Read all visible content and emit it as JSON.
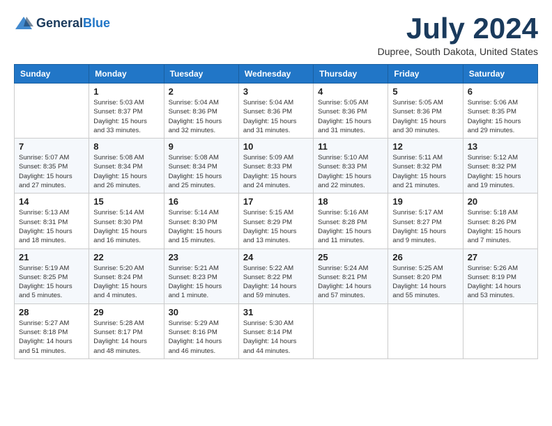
{
  "header": {
    "logo_line1": "General",
    "logo_line2": "Blue",
    "month": "July 2024",
    "location": "Dupree, South Dakota, United States"
  },
  "weekdays": [
    "Sunday",
    "Monday",
    "Tuesday",
    "Wednesday",
    "Thursday",
    "Friday",
    "Saturday"
  ],
  "weeks": [
    [
      {
        "day": "",
        "info": ""
      },
      {
        "day": "1",
        "info": "Sunrise: 5:03 AM\nSunset: 8:37 PM\nDaylight: 15 hours\nand 33 minutes."
      },
      {
        "day": "2",
        "info": "Sunrise: 5:04 AM\nSunset: 8:36 PM\nDaylight: 15 hours\nand 32 minutes."
      },
      {
        "day": "3",
        "info": "Sunrise: 5:04 AM\nSunset: 8:36 PM\nDaylight: 15 hours\nand 31 minutes."
      },
      {
        "day": "4",
        "info": "Sunrise: 5:05 AM\nSunset: 8:36 PM\nDaylight: 15 hours\nand 31 minutes."
      },
      {
        "day": "5",
        "info": "Sunrise: 5:05 AM\nSunset: 8:36 PM\nDaylight: 15 hours\nand 30 minutes."
      },
      {
        "day": "6",
        "info": "Sunrise: 5:06 AM\nSunset: 8:35 PM\nDaylight: 15 hours\nand 29 minutes."
      }
    ],
    [
      {
        "day": "7",
        "info": "Sunrise: 5:07 AM\nSunset: 8:35 PM\nDaylight: 15 hours\nand 27 minutes."
      },
      {
        "day": "8",
        "info": "Sunrise: 5:08 AM\nSunset: 8:34 PM\nDaylight: 15 hours\nand 26 minutes."
      },
      {
        "day": "9",
        "info": "Sunrise: 5:08 AM\nSunset: 8:34 PM\nDaylight: 15 hours\nand 25 minutes."
      },
      {
        "day": "10",
        "info": "Sunrise: 5:09 AM\nSunset: 8:33 PM\nDaylight: 15 hours\nand 24 minutes."
      },
      {
        "day": "11",
        "info": "Sunrise: 5:10 AM\nSunset: 8:33 PM\nDaylight: 15 hours\nand 22 minutes."
      },
      {
        "day": "12",
        "info": "Sunrise: 5:11 AM\nSunset: 8:32 PM\nDaylight: 15 hours\nand 21 minutes."
      },
      {
        "day": "13",
        "info": "Sunrise: 5:12 AM\nSunset: 8:32 PM\nDaylight: 15 hours\nand 19 minutes."
      }
    ],
    [
      {
        "day": "14",
        "info": "Sunrise: 5:13 AM\nSunset: 8:31 PM\nDaylight: 15 hours\nand 18 minutes."
      },
      {
        "day": "15",
        "info": "Sunrise: 5:14 AM\nSunset: 8:30 PM\nDaylight: 15 hours\nand 16 minutes."
      },
      {
        "day": "16",
        "info": "Sunrise: 5:14 AM\nSunset: 8:30 PM\nDaylight: 15 hours\nand 15 minutes."
      },
      {
        "day": "17",
        "info": "Sunrise: 5:15 AM\nSunset: 8:29 PM\nDaylight: 15 hours\nand 13 minutes."
      },
      {
        "day": "18",
        "info": "Sunrise: 5:16 AM\nSunset: 8:28 PM\nDaylight: 15 hours\nand 11 minutes."
      },
      {
        "day": "19",
        "info": "Sunrise: 5:17 AM\nSunset: 8:27 PM\nDaylight: 15 hours\nand 9 minutes."
      },
      {
        "day": "20",
        "info": "Sunrise: 5:18 AM\nSunset: 8:26 PM\nDaylight: 15 hours\nand 7 minutes."
      }
    ],
    [
      {
        "day": "21",
        "info": "Sunrise: 5:19 AM\nSunset: 8:25 PM\nDaylight: 15 hours\nand 5 minutes."
      },
      {
        "day": "22",
        "info": "Sunrise: 5:20 AM\nSunset: 8:24 PM\nDaylight: 15 hours\nand 4 minutes."
      },
      {
        "day": "23",
        "info": "Sunrise: 5:21 AM\nSunset: 8:23 PM\nDaylight: 15 hours\nand 1 minute."
      },
      {
        "day": "24",
        "info": "Sunrise: 5:22 AM\nSunset: 8:22 PM\nDaylight: 14 hours\nand 59 minutes."
      },
      {
        "day": "25",
        "info": "Sunrise: 5:24 AM\nSunset: 8:21 PM\nDaylight: 14 hours\nand 57 minutes."
      },
      {
        "day": "26",
        "info": "Sunrise: 5:25 AM\nSunset: 8:20 PM\nDaylight: 14 hours\nand 55 minutes."
      },
      {
        "day": "27",
        "info": "Sunrise: 5:26 AM\nSunset: 8:19 PM\nDaylight: 14 hours\nand 53 minutes."
      }
    ],
    [
      {
        "day": "28",
        "info": "Sunrise: 5:27 AM\nSunset: 8:18 PM\nDaylight: 14 hours\nand 51 minutes."
      },
      {
        "day": "29",
        "info": "Sunrise: 5:28 AM\nSunset: 8:17 PM\nDaylight: 14 hours\nand 48 minutes."
      },
      {
        "day": "30",
        "info": "Sunrise: 5:29 AM\nSunset: 8:16 PM\nDaylight: 14 hours\nand 46 minutes."
      },
      {
        "day": "31",
        "info": "Sunrise: 5:30 AM\nSunset: 8:14 PM\nDaylight: 14 hours\nand 44 minutes."
      },
      {
        "day": "",
        "info": ""
      },
      {
        "day": "",
        "info": ""
      },
      {
        "day": "",
        "info": ""
      }
    ]
  ]
}
